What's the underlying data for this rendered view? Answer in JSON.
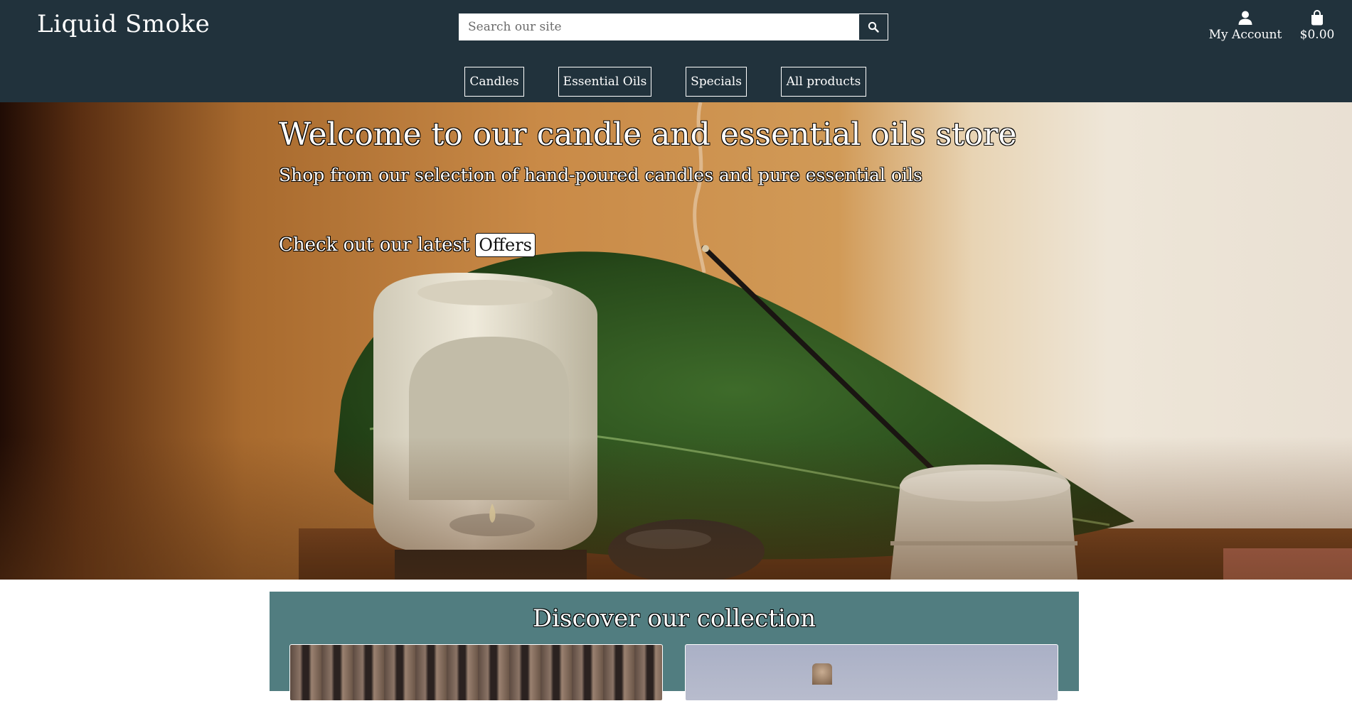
{
  "header": {
    "brand": "Liquid Smoke",
    "search": {
      "placeholder": "Search our site",
      "icon": "search-icon"
    },
    "account": {
      "label": "My Account",
      "icon": "user-icon"
    },
    "cart": {
      "total": "$0.00",
      "icon": "shopping-bag-icon"
    },
    "nav": [
      "Candles",
      "Essential Oils",
      "Specials",
      "All products"
    ]
  },
  "hero": {
    "title": "Welcome to our candle and essential oils store",
    "subtitle": "Shop from our selection of hand-poured candles and pure essential oils",
    "cta_text": "Check out our latest",
    "cta_button": "Offers"
  },
  "collection": {
    "title": "Discover our collection"
  },
  "colors": {
    "header_bg": "#21323c",
    "collection_bg": "#517d80"
  }
}
